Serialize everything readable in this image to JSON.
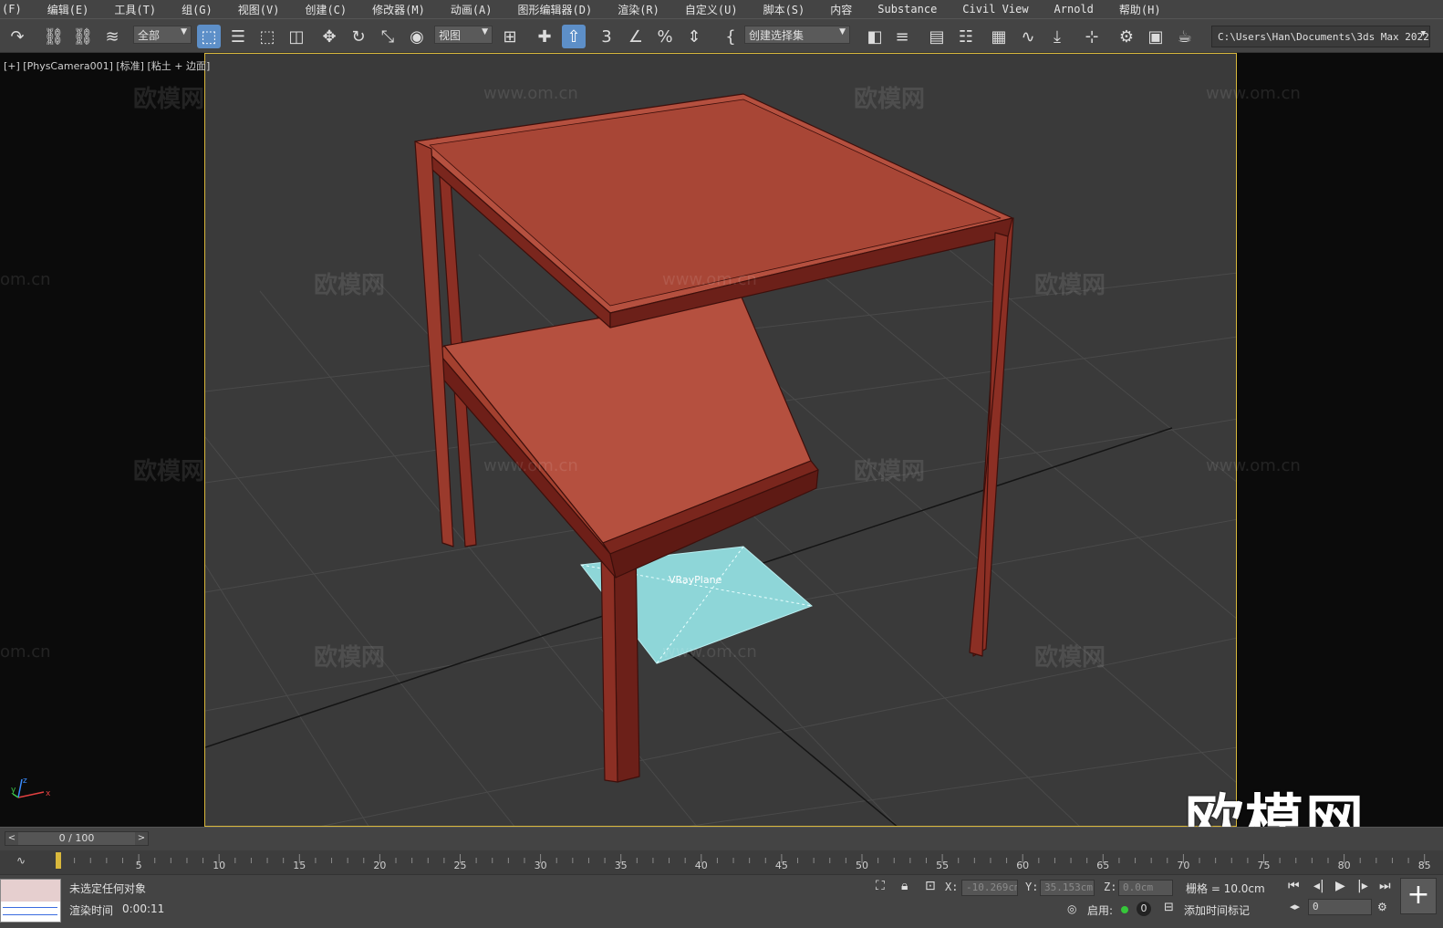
{
  "menu": [
    "(F)",
    "编辑(E)",
    "工具(T)",
    "组(G)",
    "视图(V)",
    "创建(C)",
    "修改器(M)",
    "动画(A)",
    "图形编辑器(D)",
    "渲染(R)",
    "自定义(U)",
    "脚本(S)",
    "内容",
    "Substance",
    "Civil View",
    "Arnold",
    "帮助(H)"
  ],
  "toolbar": {
    "filter_value": "全部",
    "ref_coord_value": "视图",
    "selection_set_value": "创建选择集",
    "project_path": "C:\\Users\\Han\\Documents\\3ds Max 2022"
  },
  "viewport": {
    "label": "[+] [PhysCamera001] [标准] [粘土 + 边面]",
    "object_label": "VRayPlane",
    "axis_labels": [
      "x",
      "y",
      "z"
    ]
  },
  "watermarks": {
    "brand": "欧模网",
    "url": "www.om.cn",
    "url_partial": "om.cn",
    "big": "欧模网"
  },
  "timeline": {
    "frame_counter": "0 / 100",
    "ticks": [
      "5",
      "10",
      "15",
      "20",
      "25",
      "30",
      "35",
      "40",
      "45",
      "50",
      "55",
      "60",
      "65",
      "70",
      "75",
      "80",
      "85"
    ],
    "current_frame": 0
  },
  "status": {
    "selection": "未选定任何对象",
    "render_time_label": "渲染时间",
    "render_time_value": "0:00:11",
    "x_label": "X:",
    "x_value": "-10.269cm",
    "y_label": "Y:",
    "y_value": "35.153cm",
    "z_label": "Z:",
    "z_value": "0.0cm",
    "grid": "栅格 = 10.0cm",
    "enable_label": "启用:",
    "enable_count": "0",
    "add_time_tag": "添加时间标记",
    "frame_field": "0"
  },
  "colors": {
    "table": "#b5503f",
    "table_dark": "#5e1a14",
    "plane": "#8ed6d8",
    "viewport_border": "#d9b83c",
    "active_tool": "#5d8fc8"
  }
}
